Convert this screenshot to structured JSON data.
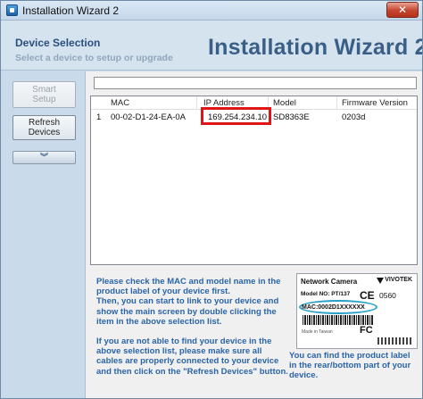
{
  "window": {
    "title": "Installation Wizard 2",
    "close_label": "✕"
  },
  "header": {
    "title": "Device Selection",
    "subtitle": "Select a device to setup or upgrade",
    "wizard_title": "Installation Wizard 2"
  },
  "buttons": {
    "smart_setup_line1": "Smart",
    "smart_setup_line2": "Setup",
    "refresh_line1": "Refresh",
    "refresh_line2": "Devices",
    "expand_glyph": "︾"
  },
  "top_field": {
    "value": ""
  },
  "device_list": {
    "columns": [
      "MAC",
      "IP Address",
      "Model",
      "Firmware Version"
    ],
    "rows": [
      {
        "index": "1",
        "mac": "00-02-D1-24-EA-0A",
        "ip": "169.254.234.10",
        "model": "SD8363E",
        "firmware": "0203d"
      }
    ]
  },
  "info": {
    "para1": "Please check the MAC and model name in the product label of your device first.",
    "para2": "Then, you can start to link to your device and show the main screen by double clicking the item in the above selection list.",
    "para3": "If you are not able to find your device in the above selection list, please make sure all cables are properly connected to your device and then click on the \"Refresh Devices\" button.",
    "label_hint": "You can find the product label in the rear/bottom part of your device."
  },
  "product_label": {
    "title": "Network Camera",
    "brand": "VIVOTEK",
    "model": "Model NO: PT/137",
    "ce": "CE",
    "cert": "0560",
    "mac": "MAC:0002D1XXXXXX",
    "fc": "FC",
    "made_in": "Made in Taiwan"
  },
  "colors": {
    "accent_text": "#2b64a8",
    "highlight": "#e01515",
    "oval": "#2aa0c8"
  }
}
